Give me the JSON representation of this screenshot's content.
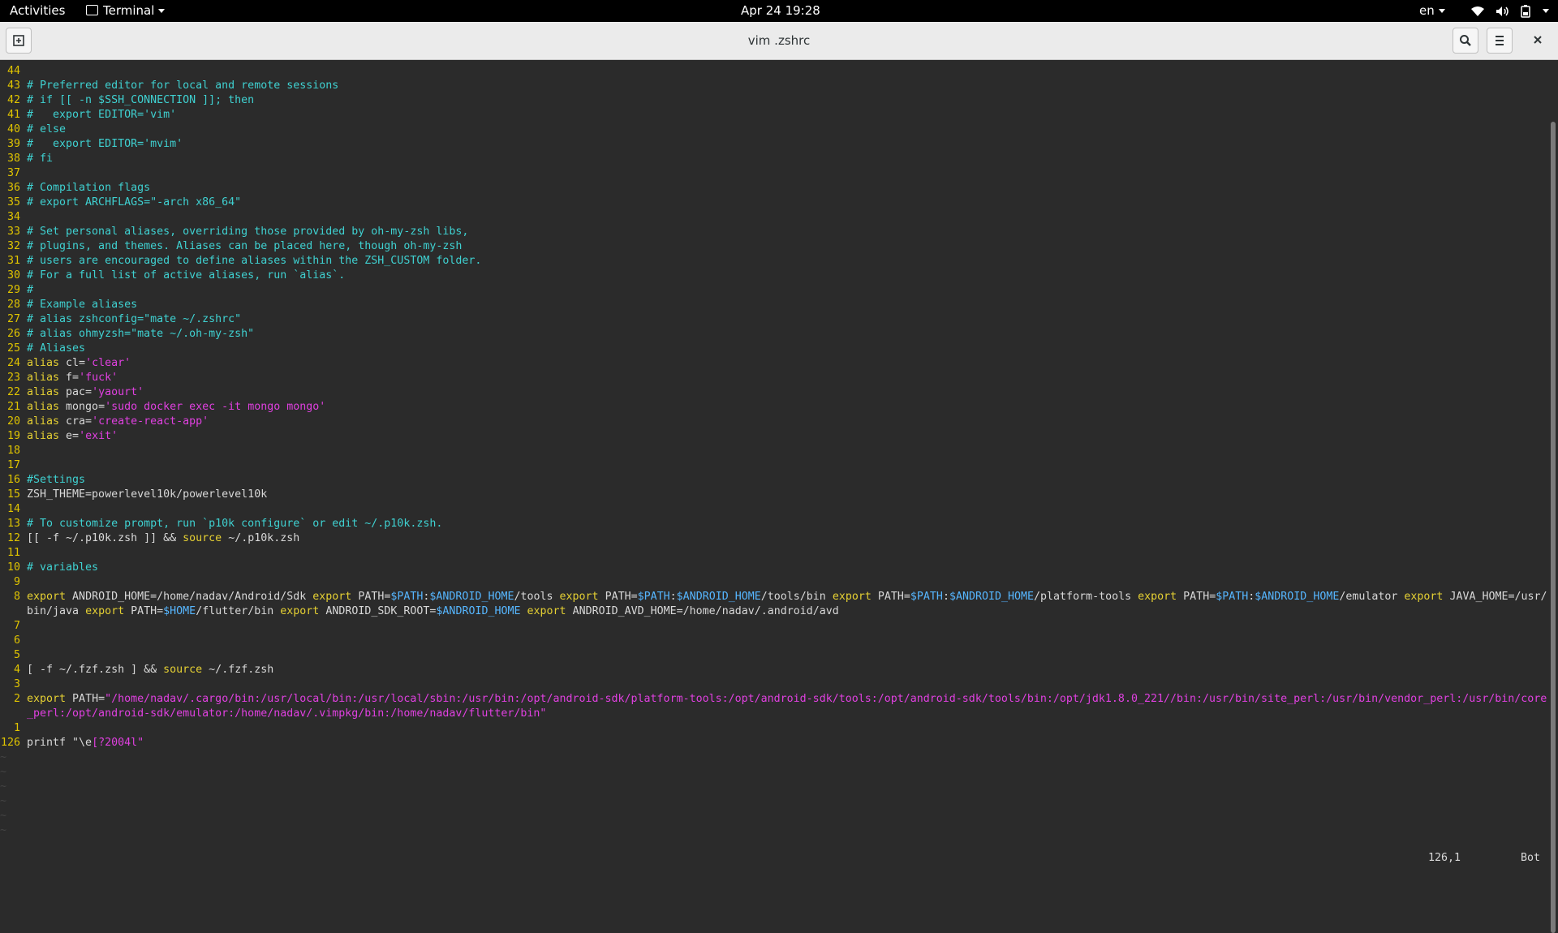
{
  "topbar": {
    "activities": "Activities",
    "app_name": "Terminal",
    "clock": "Apr 24  19:28",
    "lang": "en"
  },
  "window": {
    "title": "vim .zshrc"
  },
  "colors": {
    "comment": "#3fd1d1",
    "keyword": "#e5d033",
    "string": "#e040e0",
    "variable": "#56b6ff",
    "line_number": "#e0c400"
  },
  "editor": {
    "lines": [
      {
        "n": "44",
        "segs": []
      },
      {
        "n": "43",
        "segs": [
          {
            "t": "# Preferred editor for local and remote sessions",
            "c": "cmt"
          }
        ]
      },
      {
        "n": "42",
        "segs": [
          {
            "t": "# if [[ -n $SSH_CONNECTION ]]; then",
            "c": "cmt"
          }
        ]
      },
      {
        "n": "41",
        "segs": [
          {
            "t": "#   export EDITOR='vim'",
            "c": "cmt"
          }
        ]
      },
      {
        "n": "40",
        "segs": [
          {
            "t": "# else",
            "c": "cmt"
          }
        ]
      },
      {
        "n": "39",
        "segs": [
          {
            "t": "#   export EDITOR='mvim'",
            "c": "cmt"
          }
        ]
      },
      {
        "n": "38",
        "segs": [
          {
            "t": "# fi",
            "c": "cmt"
          }
        ]
      },
      {
        "n": "37",
        "segs": []
      },
      {
        "n": "36",
        "segs": [
          {
            "t": "# Compilation flags",
            "c": "cmt"
          }
        ]
      },
      {
        "n": "35",
        "segs": [
          {
            "t": "# export ARCHFLAGS=\"-arch x86_64\"",
            "c": "cmt"
          }
        ]
      },
      {
        "n": "34",
        "segs": []
      },
      {
        "n": "33",
        "segs": [
          {
            "t": "# Set personal aliases, overriding those provided by oh-my-zsh libs,",
            "c": "cmt"
          }
        ]
      },
      {
        "n": "32",
        "segs": [
          {
            "t": "# plugins, and themes. Aliases can be placed here, though oh-my-zsh",
            "c": "cmt"
          }
        ]
      },
      {
        "n": "31",
        "segs": [
          {
            "t": "# users are encouraged to define aliases within the ZSH_CUSTOM folder.",
            "c": "cmt"
          }
        ]
      },
      {
        "n": "30",
        "segs": [
          {
            "t": "# For a full list of active aliases, run `alias`.",
            "c": "cmt"
          }
        ]
      },
      {
        "n": "29",
        "segs": [
          {
            "t": "#",
            "c": "cmt"
          }
        ]
      },
      {
        "n": "28",
        "segs": [
          {
            "t": "# Example aliases",
            "c": "cmt"
          }
        ]
      },
      {
        "n": "27",
        "segs": [
          {
            "t": "# alias zshconfig=\"mate ~/.zshrc\"",
            "c": "cmt"
          }
        ]
      },
      {
        "n": "26",
        "segs": [
          {
            "t": "# alias ohmyzsh=\"mate ~/.oh-my-zsh\"",
            "c": "cmt"
          }
        ]
      },
      {
        "n": "25",
        "segs": [
          {
            "t": "# Aliases",
            "c": "cmt"
          }
        ]
      },
      {
        "n": "24",
        "segs": [
          {
            "t": "alias",
            "c": "kw"
          },
          {
            "t": " cl=",
            "c": "pl"
          },
          {
            "t": "'clear'",
            "c": "str"
          }
        ]
      },
      {
        "n": "23",
        "segs": [
          {
            "t": "alias",
            "c": "kw"
          },
          {
            "t": " f=",
            "c": "pl"
          },
          {
            "t": "'fuck'",
            "c": "str"
          }
        ]
      },
      {
        "n": "22",
        "segs": [
          {
            "t": "alias",
            "c": "kw"
          },
          {
            "t": " pac=",
            "c": "pl"
          },
          {
            "t": "'yaourt'",
            "c": "str"
          }
        ]
      },
      {
        "n": "21",
        "segs": [
          {
            "t": "alias",
            "c": "kw"
          },
          {
            "t": " mongo=",
            "c": "pl"
          },
          {
            "t": "'sudo docker exec -it mongo mongo'",
            "c": "str"
          }
        ]
      },
      {
        "n": "20",
        "segs": [
          {
            "t": "alias",
            "c": "kw"
          },
          {
            "t": " cra=",
            "c": "pl"
          },
          {
            "t": "'create-react-app'",
            "c": "str"
          }
        ]
      },
      {
        "n": "19",
        "segs": [
          {
            "t": "alias",
            "c": "kw"
          },
          {
            "t": " e=",
            "c": "pl"
          },
          {
            "t": "'exit'",
            "c": "str"
          }
        ]
      },
      {
        "n": "18",
        "segs": []
      },
      {
        "n": "17",
        "segs": []
      },
      {
        "n": "16",
        "segs": [
          {
            "t": "#Settings",
            "c": "cmt"
          }
        ]
      },
      {
        "n": "15",
        "segs": [
          {
            "t": "ZSH_THEME=powerlevel10k/powerlevel10k",
            "c": "pl"
          }
        ]
      },
      {
        "n": "14",
        "segs": []
      },
      {
        "n": "13",
        "segs": [
          {
            "t": "# To customize prompt, run `p10k configure` or edit ~/.p10k.zsh.",
            "c": "cmt"
          }
        ]
      },
      {
        "n": "12",
        "segs": [
          {
            "t": "[[ -f ~/.p10k.zsh ]] && ",
            "c": "pl"
          },
          {
            "t": "source",
            "c": "kw"
          },
          {
            "t": " ~/.p10k.zsh",
            "c": "pl"
          }
        ]
      },
      {
        "n": "11",
        "segs": []
      },
      {
        "n": "10",
        "segs": [
          {
            "t": "# variables",
            "c": "cmt"
          }
        ]
      },
      {
        "n": "9",
        "segs": []
      },
      {
        "n": "8",
        "segs": [
          {
            "t": "export",
            "c": "kw"
          },
          {
            "t": " ANDROID_HOME=/home/nadav/Android/Sdk ",
            "c": "pl"
          },
          {
            "t": "export",
            "c": "kw"
          },
          {
            "t": " PATH=",
            "c": "pl"
          },
          {
            "t": "$PATH",
            "c": "var"
          },
          {
            "t": ":",
            "c": "pl"
          },
          {
            "t": "$ANDROID_HOME",
            "c": "var"
          },
          {
            "t": "/tools ",
            "c": "pl"
          },
          {
            "t": "export",
            "c": "kw"
          },
          {
            "t": " PATH=",
            "c": "pl"
          },
          {
            "t": "$PATH",
            "c": "var"
          },
          {
            "t": ":",
            "c": "pl"
          },
          {
            "t": "$ANDROID_HOME",
            "c": "var"
          },
          {
            "t": "/tools/bin ",
            "c": "pl"
          },
          {
            "t": "export",
            "c": "kw"
          },
          {
            "t": " PATH=",
            "c": "pl"
          },
          {
            "t": "$PATH",
            "c": "var"
          },
          {
            "t": ":",
            "c": "pl"
          },
          {
            "t": "$ANDROID_HOME",
            "c": "var"
          },
          {
            "t": "/platform-tools ",
            "c": "pl"
          },
          {
            "t": "export",
            "c": "kw"
          },
          {
            "t": " PATH=",
            "c": "pl"
          },
          {
            "t": "$PATH",
            "c": "var"
          },
          {
            "t": ":",
            "c": "pl"
          },
          {
            "t": "$ANDROID_HOME",
            "c": "var"
          },
          {
            "t": "/emulator ",
            "c": "pl"
          },
          {
            "t": "export",
            "c": "kw"
          },
          {
            "t": " JAVA_HOME=/usr/",
            "c": "pl"
          }
        ]
      },
      {
        "n": "",
        "segs": [
          {
            "t": "bin/java ",
            "c": "pl"
          },
          {
            "t": "export",
            "c": "kw"
          },
          {
            "t": " PATH=",
            "c": "pl"
          },
          {
            "t": "$HOME",
            "c": "var"
          },
          {
            "t": "/flutter/bin ",
            "c": "pl"
          },
          {
            "t": "export",
            "c": "kw"
          },
          {
            "t": " ANDROID_SDK_ROOT=",
            "c": "pl"
          },
          {
            "t": "$ANDROID_HOME",
            "c": "var"
          },
          {
            "t": " ",
            "c": "pl"
          },
          {
            "t": "export",
            "c": "kw"
          },
          {
            "t": " ANDROID_AVD_HOME=/home/nadav/.android/avd",
            "c": "pl"
          }
        ]
      },
      {
        "n": "7",
        "segs": []
      },
      {
        "n": "6",
        "segs": []
      },
      {
        "n": "5",
        "segs": []
      },
      {
        "n": "4",
        "segs": [
          {
            "t": "[ -f ~/.fzf.zsh ] && ",
            "c": "pl"
          },
          {
            "t": "source",
            "c": "kw"
          },
          {
            "t": " ~/.fzf.zsh",
            "c": "pl"
          }
        ]
      },
      {
        "n": "3",
        "segs": []
      },
      {
        "n": "2",
        "segs": [
          {
            "t": "export",
            "c": "kw"
          },
          {
            "t": " PATH=",
            "c": "pl"
          },
          {
            "t": "\"/home/nadav/.cargo/bin:/usr/local/bin:/usr/local/sbin:/usr/bin:/opt/android-sdk/platform-tools:/opt/android-sdk/tools:/opt/android-sdk/tools/bin:/opt/jdk1.8.0_221//bin:/usr/bin/site_perl:/usr/bin/vendor_perl:/usr/bin/core",
            "c": "str"
          }
        ]
      },
      {
        "n": "",
        "segs": [
          {
            "t": "_perl:/opt/android-sdk/emulator:/home/nadav/.vimpkg/bin:/home/nadav/flutter/bin\"",
            "c": "str"
          }
        ]
      },
      {
        "n": "1",
        "segs": []
      },
      {
        "n": "126",
        "segs": [
          {
            "t": "printf ",
            "c": "pl"
          },
          {
            "t": "\"\\e",
            "c": "pl"
          },
          {
            "t": "[?2004l\"",
            "c": "str"
          }
        ]
      }
    ],
    "tilde_count": 6,
    "tilde_char": "~",
    "cursor_position": "126,1",
    "scroll_position": "Bot"
  }
}
